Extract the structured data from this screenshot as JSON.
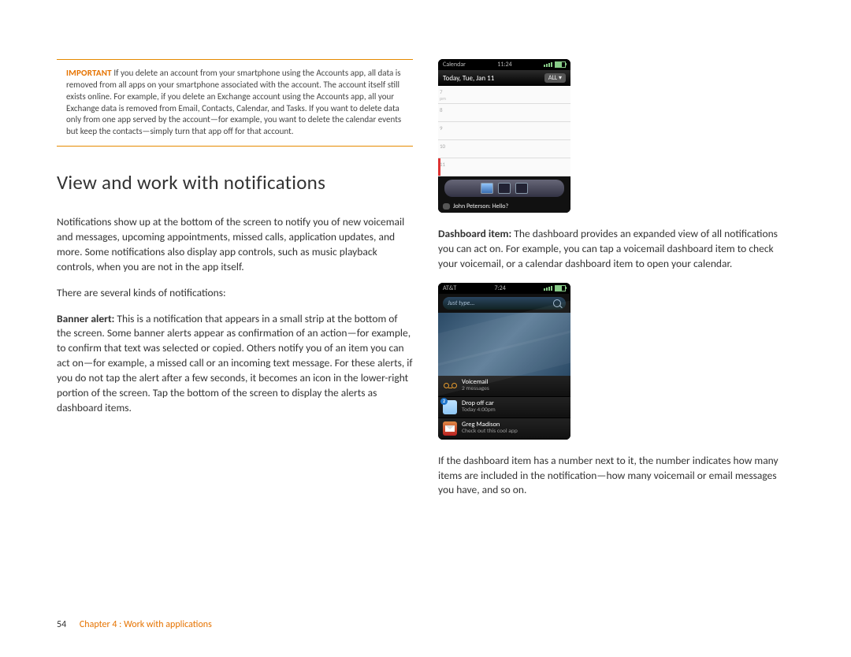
{
  "important": {
    "label": "IMPORTANT",
    "text": "If you delete an account from your smartphone using the Accounts app, all data is removed from all apps on your smartphone associated with the account. The account itself still exists online. For example, if you delete an Exchange account using the Accounts app, all your Exchange data is removed from Email, Contacts, Calendar, and Tasks. If you want to delete data only from one app served by the account—for example, you want to delete the calendar events but keep the contacts—simply turn that app off for that account."
  },
  "section_title": "View and work with notifications",
  "left": {
    "p1": "Notifications show up at the bottom of the screen to notify you of new voicemail and messages, upcoming appointments, missed calls, application updates, and more. Some notifications also display app controls, such as music playback controls, when you are not in the app itself.",
    "p2": "There are several kinds of notifications:",
    "banner_label": "Banner alert:",
    "banner_text": " This is a notification that appears in a small strip at the bottom of the screen. Some banner alerts appear as confirmation of an action—for example, to confirm that text was selected or copied. Others notify you of an item you can act on—for example, a missed call or an incoming text message. For these alerts, if you do not tap the alert after a few seconds, it becomes an icon in the lower-right portion of the screen. Tap the bottom of the screen to display the alerts as dashboard items."
  },
  "right": {
    "dash_label": "Dashboard item:",
    "dash_text": " The dashboard provides an expanded view of all notifications you can act on. For example, you can tap a voicemail dashboard item to check your voicemail, or a calendar dashboard item to open your calendar.",
    "p2": "If the dashboard item has a number next to it, the number indicates how many items are included in the notification—how many voicemail or email messages you have, and so on."
  },
  "phone1": {
    "carrier": "Calendar",
    "time": "11:24",
    "date": "Today, Tue, Jan 11",
    "all": "ALL ▾",
    "hours": [
      "7",
      "8",
      "9",
      "10",
      "11"
    ],
    "pm_caption": "pm",
    "banner_text": "John Peterson: Hello?"
  },
  "phone2": {
    "carrier": "AT&T",
    "time": "7:24",
    "search_placeholder": "Just type...",
    "items": [
      {
        "title": "Voicemail",
        "sub": "2 messages",
        "kind": "vm",
        "badge": ""
      },
      {
        "title": "Drop off car",
        "sub": "Today 4:00pm",
        "kind": "cal",
        "badge": "2"
      },
      {
        "title": "Greg Madison",
        "sub": "Check out this cool app",
        "kind": "mail",
        "badge": ""
      }
    ]
  },
  "footer": {
    "page": "54",
    "chapter": "Chapter 4 : Work with applications"
  }
}
